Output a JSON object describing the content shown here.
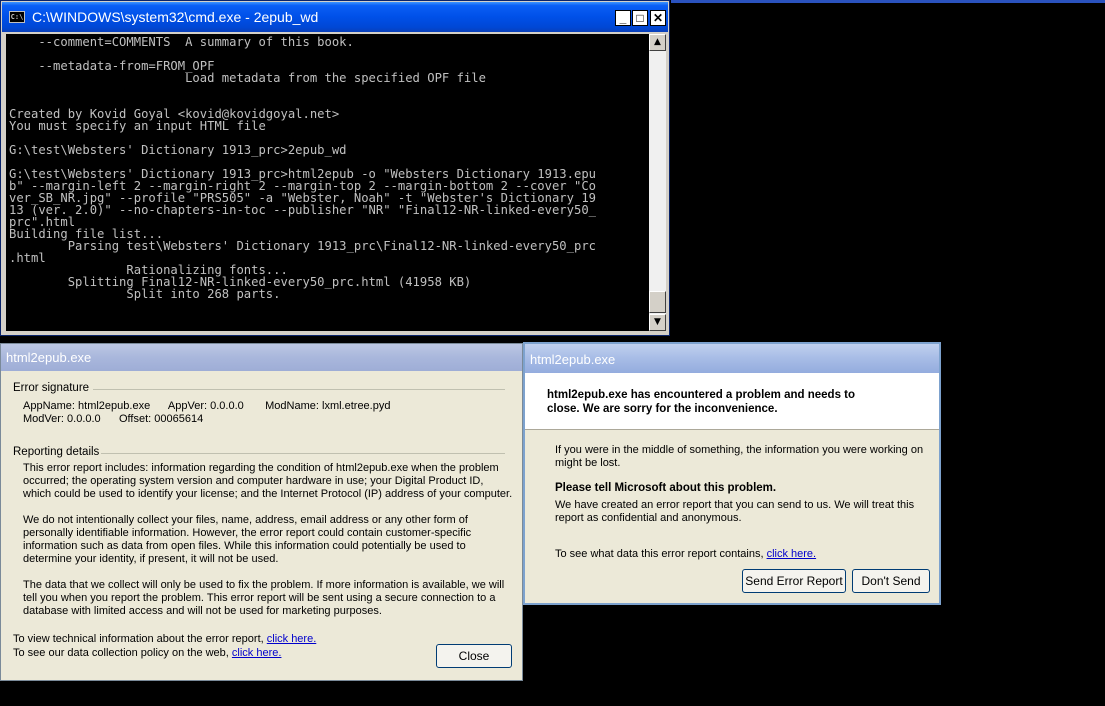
{
  "cmd_window": {
    "title": "C:\\WINDOWS\\system32\\cmd.exe - 2epub_wd",
    "icon_label": "C:\\",
    "min_label": "_",
    "max_label": "□",
    "close_label": "✕",
    "console_text": "    --comment=COMMENTS  A summary of this book.\n\n    --metadata-from=FROM_OPF\n                        Load metadata from the specified OPF file\n\n\nCreated by Kovid Goyal <kovid@kovidgoyal.net>\nYou must specify an input HTML file\n\nG:\\test\\Websters' Dictionary 1913_prc>2epub_wd\n\nG:\\test\\Websters' Dictionary 1913_prc>html2epub -o \"Websters Dictionary 1913.epu\nb\" --margin-left 2 --margin-right 2 --margin-top 2 --margin-bottom 2 --cover \"Co\nver_SB_NR.jpg\" --profile \"PRS505\" -a \"Webster, Noah\" -t \"Webster's Dictionary 19\n13 (ver. 2.0)\" --no-chapters-in-toc --publisher \"NR\" \"Final12-NR-linked-every50_\nprc\".html\nBuilding file list...\n        Parsing test\\Websters' Dictionary 1913_prc\\Final12-NR-linked-every50_prc\n.html\n                Rationalizing fonts...\n        Splitting Final12-NR-linked-every50_prc.html (41958 KB)\n                Split into 268 parts."
  },
  "details_dialog": {
    "title": "html2epub.exe",
    "error_signature_heading": "Error signature",
    "sig_line1": "AppName: html2epub.exe      AppVer: 0.0.0.0       ModName: lxml.etree.pyd",
    "sig_line2": "ModVer: 0.0.0.0      Offset: 00065614",
    "reporting_heading": "Reporting details",
    "para1": "This error report includes: information regarding the condition of html2epub.exe when the problem occurred; the operating system version and computer hardware in use; your Digital Product ID, which could be used to identify your license; and the Internet Protocol (IP) address of your computer.",
    "para2": "We do not intentionally collect your files, name, address, email address or any other form of personally identifiable information. However, the error report could contain customer-specific information such as data from open files. While this information could potentially be used to determine your identity, if present, it will not be used.",
    "para3": "The data that we collect will only be used to fix the problem. If more information is available, we will tell you when you report the problem. This error report will be sent using a secure connection to a database with limited access and will not be used for marketing purposes.",
    "tech_prefix": "To view technical information about the error report,",
    "tech_link": "click here.",
    "policy_prefix": "To see our data collection policy on the web,",
    "policy_link": "click here.",
    "close_label": "Close"
  },
  "error_dialog": {
    "title": "html2epub.exe",
    "headline": "html2epub.exe has encountered a problem and needs to close.  We are sorry for the inconvenience.",
    "middle_text": "If you were in the middle of something, the information you were working on might be lost.",
    "tell_heading": "Please tell Microsoft about this problem.",
    "report_text": "We have created an error report that you can send to us.  We will treat this report as confidential and anonymous.",
    "see_data_prefix": "To see what data this error report contains,",
    "see_data_link": "click here.",
    "send_label": "Send Error Report",
    "dont_send_label": "Don't Send"
  }
}
